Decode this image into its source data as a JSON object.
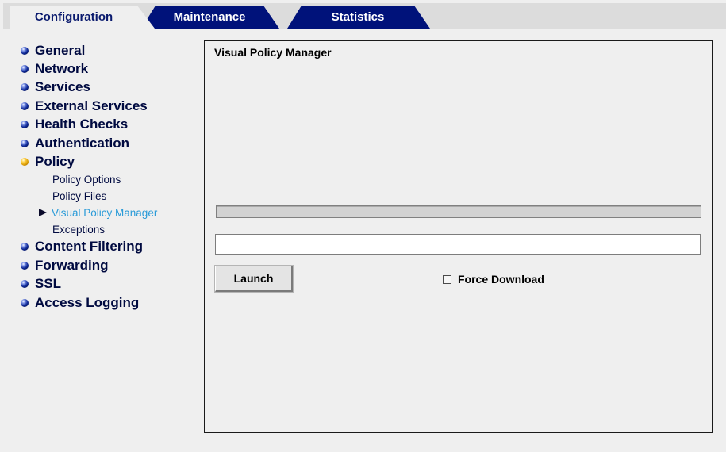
{
  "tabs": [
    {
      "label": "Configuration",
      "active": true
    },
    {
      "label": "Maintenance",
      "active": false
    },
    {
      "label": "Statistics",
      "active": false
    }
  ],
  "sidebar": {
    "items": [
      {
        "label": "General",
        "icon": "blue-ball-icon"
      },
      {
        "label": "Network",
        "icon": "blue-ball-icon"
      },
      {
        "label": "Services",
        "icon": "blue-ball-icon"
      },
      {
        "label": "External Services",
        "icon": "blue-ball-icon"
      },
      {
        "label": "Health Checks",
        "icon": "blue-ball-icon"
      },
      {
        "label": "Authentication",
        "icon": "blue-ball-icon"
      },
      {
        "label": "Policy",
        "icon": "gold-ball-icon",
        "expanded": true
      },
      {
        "label": "Content Filtering",
        "icon": "blue-ball-icon"
      },
      {
        "label": "Forwarding",
        "icon": "blue-ball-icon"
      },
      {
        "label": "SSL",
        "icon": "blue-ball-icon"
      },
      {
        "label": "Access Logging",
        "icon": "blue-ball-icon"
      }
    ],
    "policy_subitems": [
      {
        "label": "Policy Options",
        "current": false
      },
      {
        "label": "Policy Files",
        "current": false
      },
      {
        "label": "Visual Policy Manager",
        "current": true
      },
      {
        "label": "Exceptions",
        "current": false
      }
    ]
  },
  "main": {
    "title": "Visual Policy Manager",
    "progress": 0,
    "path_value": "",
    "launch_label": "Launch",
    "force_download_label": "Force Download",
    "force_download_checked": false
  },
  "colors": {
    "tab_dark": "#00127a",
    "nav_text": "#000a40",
    "current_subitem": "#2a9bd8",
    "background": "#efefef"
  }
}
